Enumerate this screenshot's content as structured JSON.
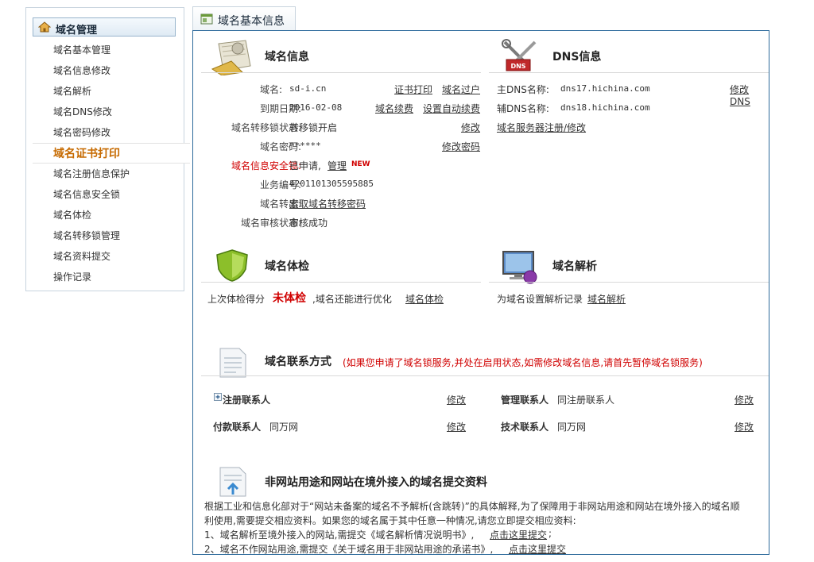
{
  "sidebar": {
    "title": "域名管理",
    "items": [
      {
        "label": "域名基本管理"
      },
      {
        "label": "域名信息修改"
      },
      {
        "label": "域名解析"
      },
      {
        "label": "域名DNS修改"
      },
      {
        "label": "域名密码修改"
      },
      {
        "label": "域名证书打印"
      },
      {
        "label": "域名注册信息保护"
      },
      {
        "label": "域名信息安全锁"
      },
      {
        "label": "域名体检"
      },
      {
        "label": "域名转移锁管理"
      },
      {
        "label": "域名资料提交"
      },
      {
        "label": "操作记录"
      }
    ],
    "active_index": 5
  },
  "tab": {
    "label": "域名基本信息"
  },
  "domain_info": {
    "title": "域名信息",
    "domain_label": "域名:",
    "domain_value": "sd-i.cn",
    "cert_print": "证书打印",
    "transfer_out": "域名过户",
    "expiry_label": "到期日期:",
    "expiry_value": "2016-02-08",
    "renew": "域名续费",
    "auto_renew": "设置自动续费",
    "transfer_lock_label": "域名转移锁状态:",
    "transfer_lock_value": "转移锁开启",
    "modify": "修改",
    "password_label": "域名密码:",
    "password_value": "******",
    "modify_password": "修改密码",
    "security_lock_label": "域名信息安全锁:",
    "security_lock_value": "已申请,",
    "manage": "管理",
    "new_badge": "NEW",
    "business_no_label": "业务编号:",
    "business_no_value": "4201101305595885",
    "transfer_label": "域名转出:",
    "transfer_link": "索取域名转移密码",
    "audit_label": "域名审核状态:",
    "audit_value": "审核成功"
  },
  "dns_info": {
    "title": "DNS信息",
    "icon_text": "DNS",
    "primary_label": "主DNS名称:",
    "primary_value": "dns17.hichina.com",
    "modify_dns": "修改DNS",
    "secondary_label": "辅DNS名称:",
    "secondary_value": "dns18.hichina.com",
    "server_register": "域名服务器注册/修改"
  },
  "health_check": {
    "title": "域名体检",
    "text_before": "上次体检得分",
    "score": "未体检",
    "text_after": ",域名还能进行优化",
    "link": "域名体检"
  },
  "resolution": {
    "title": "域名解析",
    "text": "为域名设置解析记录",
    "link": "域名解析"
  },
  "contacts": {
    "title": "域名联系方式",
    "notice": "(如果您申请了域名锁服务,并处在启用状态,如需修改域名信息,请首先暂停域名锁服务)",
    "registrant_label": "注册联系人",
    "registrant_modify": "修改",
    "admin_label": "管理联系人",
    "admin_value": "同注册联系人",
    "admin_modify": "修改",
    "billing_label": "付款联系人",
    "billing_value": "同万网",
    "billing_modify": "修改",
    "tech_label": "技术联系人",
    "tech_value": "同万网",
    "tech_modify": "修改"
  },
  "submission": {
    "title": "非网站用途和网站在境外接入的域名提交资料",
    "para1": "根据工业和信息化部对于“网站未备案的域名不予解析(含跳转)”的具体解释,为了保障用于非网站用途和网站在境外接入的域名顺",
    "para2": "利使用,需要提交相应资料。如果您的域名属于其中任意一种情况,请您立即提交相应资料:",
    "item1_text": "1、域名解析至境外接入的网站,需提交《域名解析情况说明书》,",
    "item1_link": "点击这里提交",
    "item1_end": ";",
    "item2_text": "2、域名不作网站用途,需提交《关于域名用于非网站用途的承诺书》,",
    "item2_link": "点击这里提交"
  }
}
